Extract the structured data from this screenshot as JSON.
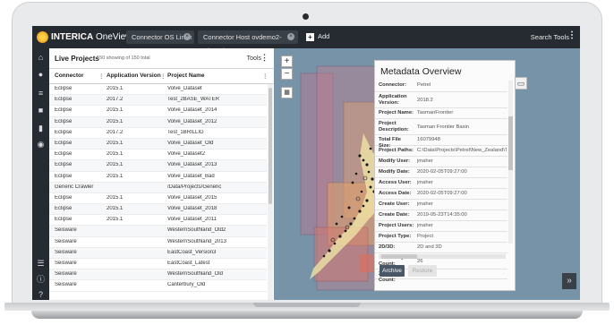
{
  "app": {
    "brand_bold": "INTERICA",
    "brand_light": " OneView",
    "accent": "#f0a020"
  },
  "tabs": [
    {
      "label": "Connector OS Linux"
    },
    {
      "label": "Connector Host ovdemo2-winnode"
    }
  ],
  "toolbar": {
    "add_label": "Add",
    "search_tools_label": "Search Tools"
  },
  "rail": {
    "icons": [
      "home-icon",
      "location-pin-icon",
      "list-icon",
      "folder-icon",
      "file-icon",
      "globe-icon",
      "menu-icon",
      "info-icon",
      "help-icon"
    ]
  },
  "projects": {
    "title": "Live Projects",
    "subtitle": "150 showing of 150 total",
    "tools_label": "Tools",
    "columns": [
      "Connector",
      "Application Version",
      "Project Name"
    ],
    "rows": [
      [
        "Eclipse",
        "2015.1",
        "Volve_Dataset"
      ],
      [
        "Eclipse",
        "2017.2",
        "Test_2BASE_WATER"
      ],
      [
        "Eclipse",
        "2015.1",
        "Volve_Dataset_2014"
      ],
      [
        "Eclipse",
        "2015.1",
        "Volve_Dataset_2012"
      ],
      [
        "Eclipse",
        "2017.2",
        "Test_1BRILLIG"
      ],
      [
        "Eclipse",
        "2015.1",
        "Volve_Dataset_Old"
      ],
      [
        "Eclipse",
        "2015.1",
        "Volve_Dataset2"
      ],
      [
        "Eclipse",
        "2015.1",
        "Volve_Dataset_2013"
      ],
      [
        "Eclipse",
        "2015.1",
        "Volve_Dataset_Bad"
      ],
      [
        "Generic Crawler",
        "",
        "/Data/Projects/Generic"
      ],
      [
        "Eclipse",
        "2015.1",
        "Volve_Dataset_2015"
      ],
      [
        "Eclipse",
        "2015.1",
        "Volve_Dataset_2018"
      ],
      [
        "Eclipse",
        "2015.1",
        "Volve_Dataset_2011"
      ],
      [
        "Seisware",
        "",
        "WesternSouthland_Old2"
      ],
      [
        "Seisware",
        "",
        "WesternSouthland_2013"
      ],
      [
        "Seisware",
        "",
        "EastCoast_Version3"
      ],
      [
        "Seisware",
        "",
        "EastCoast_Latest"
      ],
      [
        "Seisware",
        "",
        "WesternSouthland_Old"
      ],
      [
        "Seisware",
        "",
        "Canterbury_Old"
      ]
    ]
  },
  "metadata": {
    "title": "Metadata Overview",
    "archive_label": "Archive",
    "restore_label": "Restore",
    "fields": [
      {
        "k": "Connector:",
        "v": "Petrel",
        "h": 12
      },
      {
        "k": "Application Version:",
        "v": "2018.2",
        "h": 17
      },
      {
        "k": "Project Name:",
        "v": "TasmanFrontier",
        "h": 11
      },
      {
        "k": "Project Description:",
        "v": "Tasman Frontier Basin",
        "h": 17
      },
      {
        "k": "Total File Size:",
        "v": "16079948",
        "h": 11
      },
      {
        "k": "Project Paths:",
        "v": "C:\\Data\\Projects\\Petrel\\New_Zealand\\T",
        "h": 11
      },
      {
        "k": "Modify User:",
        "v": "jmaher",
        "h": 11
      },
      {
        "k": "Modify Date:",
        "v": "2020-02-05T09:27:00",
        "h": 11
      },
      {
        "k": "Access User:",
        "v": "jmaher",
        "h": 11
      },
      {
        "k": "Access Date:",
        "v": "2020-02-05T09:27:00",
        "h": 11
      },
      {
        "k": "Create User:",
        "v": "jmaher",
        "h": 11
      },
      {
        "k": "Create Date:",
        "v": "2019-05-23T14:35:00",
        "h": 11
      },
      {
        "k": "Project Users:",
        "v": "jmaher",
        "h": 11
      },
      {
        "k": "Project Type:",
        "v": "Project",
        "h": 11
      },
      {
        "k": "2D/3D:",
        "v": "2D and 3D",
        "h": 11
      },
      {
        "k": "2D Survey Count:",
        "v": "26",
        "h": 17
      },
      {
        "k": "2D Line Count:",
        "v": "412",
        "h": 10
      }
    ]
  }
}
